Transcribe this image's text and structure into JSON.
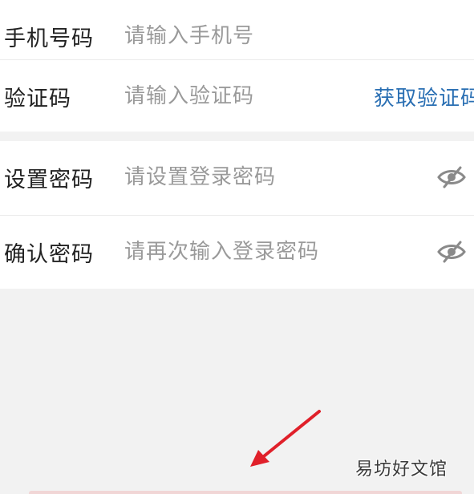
{
  "form": {
    "phone": {
      "label": "手机号码",
      "placeholder": "请输入手机号"
    },
    "code": {
      "label": "验证码",
      "placeholder": "请输入验证码",
      "get_code_label": "获取验证码"
    },
    "password": {
      "label": "设置密码",
      "placeholder": "请设置登录密码",
      "toggle_icon": "eye-hidden-icon"
    },
    "confirm_password": {
      "label": "确认密码",
      "placeholder": "请再次输入登录密码",
      "toggle_icon": "eye-hidden-icon"
    }
  },
  "annotation": {
    "arrow_color": "#e0202a",
    "watermark": "易坊好文馆"
  },
  "colors": {
    "link": "#2a6fb3",
    "placeholder": "#9a9a9a",
    "background": "#f2f2f2"
  }
}
